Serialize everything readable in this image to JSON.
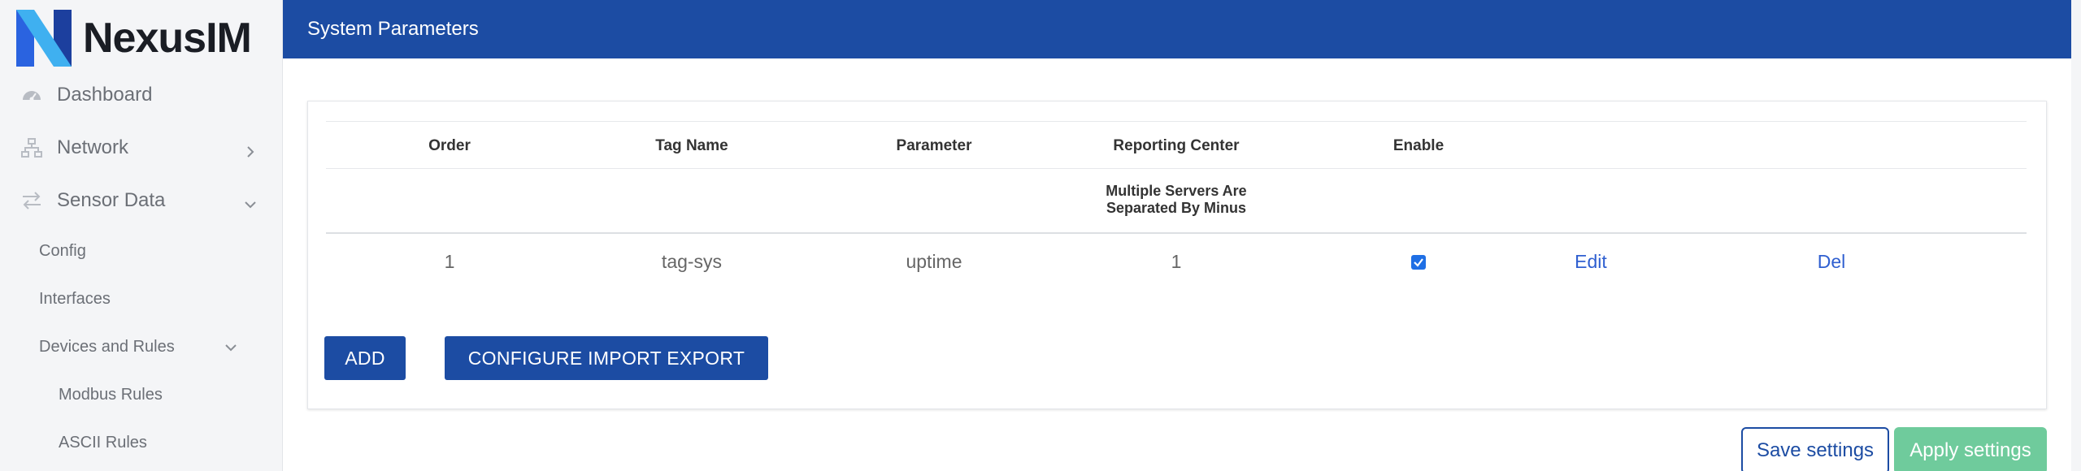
{
  "brand": {
    "name": "NexusIM"
  },
  "sidebar": {
    "items": [
      {
        "label": "Dashboard",
        "icon": "dashboard-icon"
      },
      {
        "label": "Network",
        "icon": "network-icon"
      },
      {
        "label": "Sensor Data",
        "icon": "transfer-icon"
      }
    ],
    "sub_items": [
      {
        "label": "Config"
      },
      {
        "label": "Interfaces"
      },
      {
        "label": "Devices and Rules"
      }
    ],
    "sub_sub_items": [
      {
        "label": "Modbus Rules"
      },
      {
        "label": "ASCII Rules"
      }
    ]
  },
  "header": {
    "title": "System Parameters"
  },
  "table": {
    "columns": [
      "Order",
      "Tag Name",
      "Parameter",
      "Reporting Center",
      "Enable"
    ],
    "reporting_center_note": "Multiple Servers Are\nSeparated By Minus",
    "rows": [
      {
        "order": "1",
        "tag_name": "tag-sys",
        "parameter": "uptime",
        "reporting_center": "1",
        "enable": true,
        "edit_label": "Edit",
        "del_label": "Del"
      }
    ]
  },
  "actions": {
    "add_label": "ADD",
    "configure_label": "CONFIGURE IMPORT EXPORT",
    "save_label": "Save settings",
    "apply_label": "Apply settings"
  },
  "colors": {
    "primary": "#1c4ca3",
    "apply": "#6fcb9c",
    "link": "#2f5fd0"
  }
}
